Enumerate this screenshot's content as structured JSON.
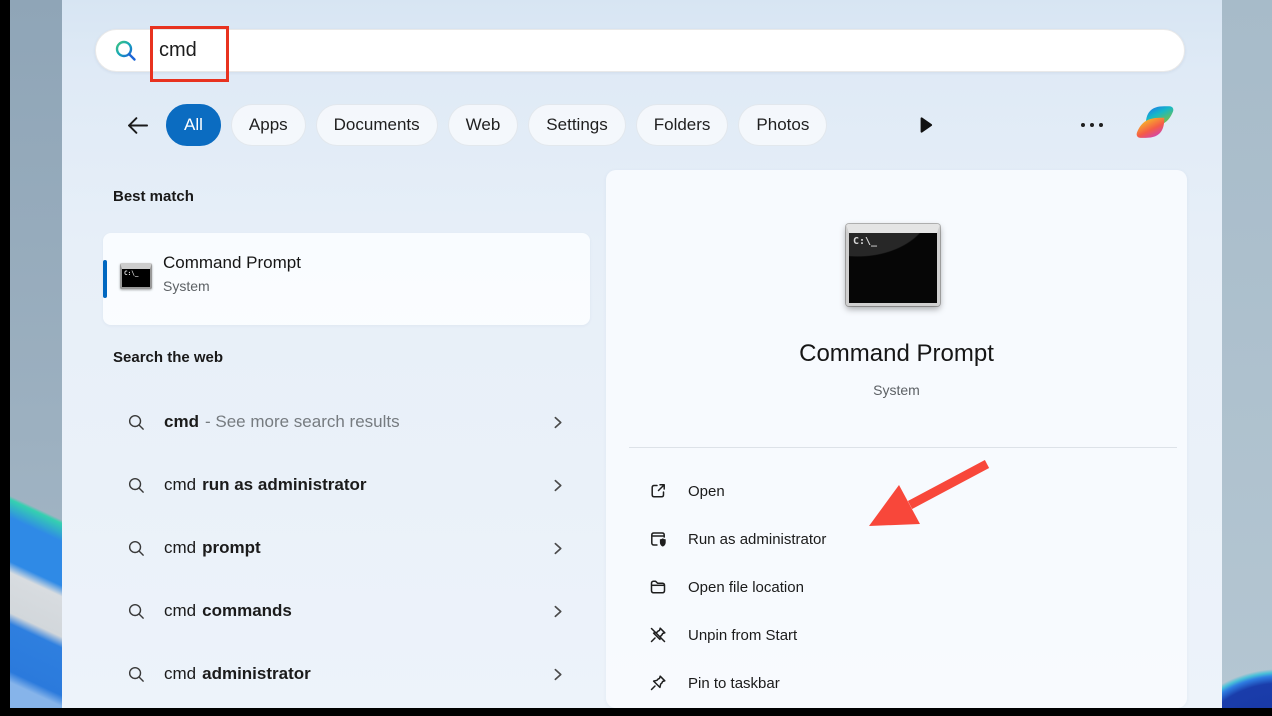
{
  "search": {
    "query": "cmd"
  },
  "tabs": {
    "items": [
      {
        "label": "All",
        "active": true
      },
      {
        "label": "Apps",
        "active": false
      },
      {
        "label": "Documents",
        "active": false
      },
      {
        "label": "Web",
        "active": false
      },
      {
        "label": "Settings",
        "active": false
      },
      {
        "label": "Folders",
        "active": false
      },
      {
        "label": "Photos",
        "active": false
      }
    ]
  },
  "best_match": {
    "header": "Best match",
    "result": {
      "name": "Command Prompt",
      "type": "System",
      "icon_text": "C:\\_"
    }
  },
  "search_the_web": {
    "header": "Search the web",
    "suggestions": [
      {
        "query": "cmd",
        "suffix": "- See more search results"
      },
      {
        "query": "cmd",
        "suffix": "run as administrator"
      },
      {
        "query": "cmd",
        "suffix": "prompt"
      },
      {
        "query": "cmd",
        "suffix": "commands"
      },
      {
        "query": "cmd",
        "suffix": "administrator"
      }
    ]
  },
  "preview": {
    "app_name": "Command Prompt",
    "app_type": "System",
    "icon_text": "C:\\_",
    "actions": [
      {
        "label": "Open",
        "icon": "open-icon"
      },
      {
        "label": "Run as administrator",
        "icon": "admin-shield-icon"
      },
      {
        "label": "Open file location",
        "icon": "folder-icon"
      },
      {
        "label": "Unpin from Start",
        "icon": "unpin-icon"
      },
      {
        "label": "Pin to taskbar",
        "icon": "pin-icon"
      }
    ]
  },
  "annotations": {
    "box_target": "cmd",
    "arrow_target": "Run as administrator",
    "box_color": "#e8321f",
    "arrow_color": "#f8473a"
  },
  "colors": {
    "accent": "#0b6cc1",
    "accent_bar": "#0067c0"
  }
}
